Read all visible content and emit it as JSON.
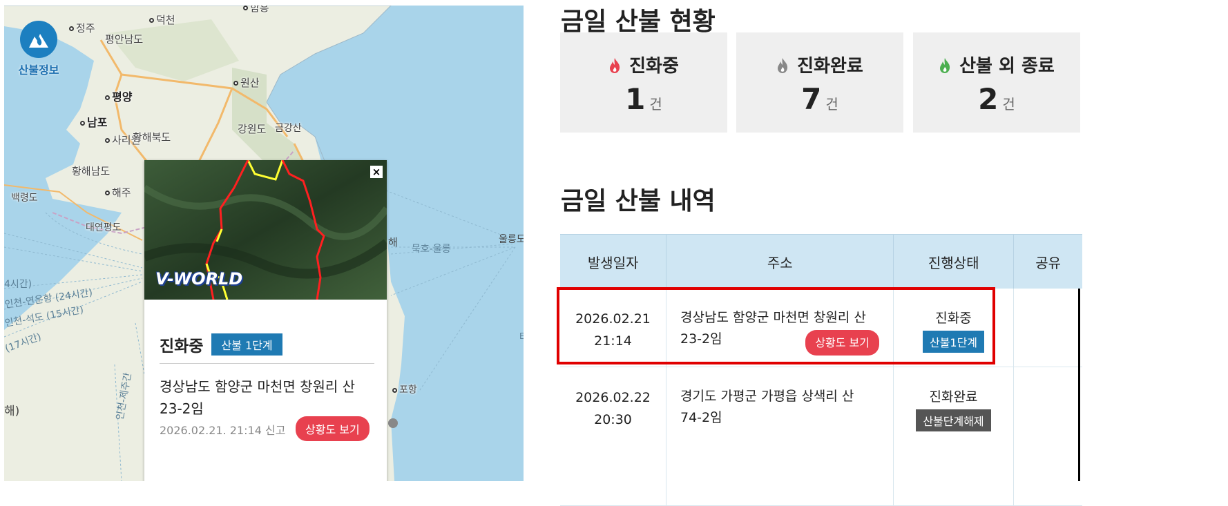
{
  "map": {
    "logo_label": "산불정보",
    "labels": [
      {
        "text": "정주",
        "type": "dot"
      },
      {
        "text": "덕천",
        "type": "dot"
      },
      {
        "text": "함흥",
        "type": "dot"
      },
      {
        "text": "평안남도",
        "type": "region"
      },
      {
        "text": "평양",
        "type": "city"
      },
      {
        "text": "원산",
        "type": "dot"
      },
      {
        "text": "남포",
        "type": "city"
      },
      {
        "text": "사리원",
        "type": "dot"
      },
      {
        "text": "황해북도",
        "type": "region"
      },
      {
        "text": "강원도",
        "type": "region"
      },
      {
        "text": "금강산",
        "type": "region"
      },
      {
        "text": "황해남도",
        "type": "region"
      },
      {
        "text": "해주",
        "type": "dot"
      },
      {
        "text": "백령도",
        "type": "region"
      },
      {
        "text": "대연평도",
        "type": "region"
      },
      {
        "text": "4시간)",
        "type": "sea"
      },
      {
        "text": "인천-연운항 (24시간)",
        "type": "sea"
      },
      {
        "text": "인천-석도 (15시간)",
        "type": "sea"
      },
      {
        "text": "(17시간)",
        "type": "sea"
      },
      {
        "text": "인천-제주간",
        "type": "sea"
      },
      {
        "text": "해)",
        "type": "sea"
      },
      {
        "text": "해",
        "type": "sea"
      },
      {
        "text": "묵호-울릉",
        "type": "sea"
      },
      {
        "text": "울릉도",
        "type": "sea"
      },
      {
        "text": "포항",
        "type": "dot"
      },
      {
        "text": "E",
        "type": "sea"
      }
    ]
  },
  "popup": {
    "close": "×",
    "watermark": "V-WORLD",
    "status": "진화중",
    "stage": "산불 1단계",
    "address": "경상남도 함양군 마천면 창원리 산23-2임",
    "date": "2026.02.21. 21:14 신고",
    "view_button": "상황도 보기"
  },
  "summary": {
    "title": "금일 산불 현황",
    "cards": [
      {
        "label": "진화중",
        "count": "1",
        "unit": "건",
        "icon": "flame-red-icon",
        "color": "#e8414f"
      },
      {
        "label": "진화완료",
        "count": "7",
        "unit": "건",
        "icon": "flame-gray-icon",
        "color": "#888888"
      },
      {
        "label": "산불 외 종료",
        "count": "2",
        "unit": "건",
        "icon": "flame-green-icon",
        "color": "#4caf50"
      }
    ]
  },
  "history": {
    "title": "금일 산불 내역",
    "headers": [
      "발생일자",
      "주소",
      "진행상태",
      "공유"
    ],
    "rows": [
      {
        "date": "2026.02.21",
        "time": "21:14",
        "address_line1": "경상남도 함양군 마천면 창원리 산",
        "address_line2": "23-2임",
        "view_button": "상황도 보기",
        "status": "진화중",
        "stage": "산불1단계",
        "stage_color": "#1f7ab3"
      },
      {
        "date": "2026.02.22",
        "time": "20:30",
        "address_line1": "경기도 가평군 가평읍 상색리 산",
        "address_line2": "74-2임",
        "status": "진화완료",
        "stage": "산불단계해제",
        "stage_color": "#555555"
      }
    ]
  }
}
